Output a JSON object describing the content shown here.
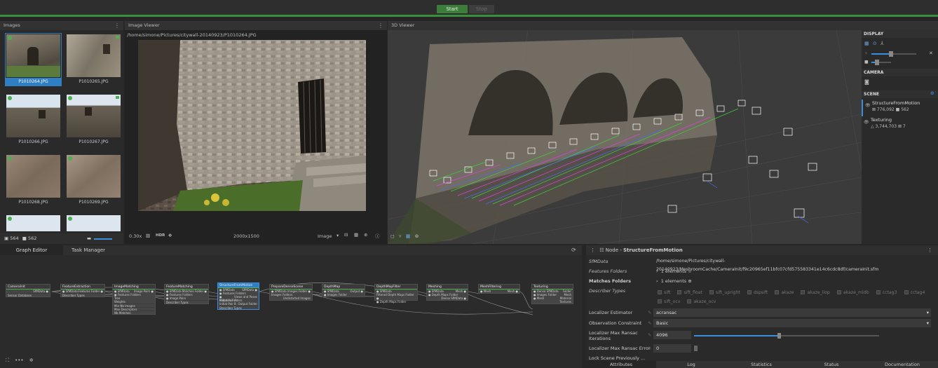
{
  "toolbar": {
    "start": "Start",
    "stop": "Stop"
  },
  "images_panel": {
    "title": "Images",
    "menu": "⋮",
    "counts": {
      "images": "564",
      "cameras": "562"
    },
    "thumbs": [
      {
        "label": "P1010264.JPG"
      },
      {
        "label": "P1010265.JPG"
      },
      {
        "label": "P1010266.JPG"
      },
      {
        "label": "P1010267.JPG"
      },
      {
        "label": "P1010268.JPG"
      },
      {
        "label": "P1010269.JPG"
      }
    ]
  },
  "image_viewer": {
    "title": "Image Viewer",
    "menu": "⋮",
    "path": "/home/simone/Pictures/citywall-20140923/P1010264.JPG",
    "zoom": "0.30x",
    "hdr": "HDR",
    "resolution": "2000x1500",
    "mode": "Image"
  },
  "viewer3d": {
    "title": "3D Viewer"
  },
  "display_panel": {
    "display": "DISPLAY",
    "camera": "CAMERA",
    "scene": "SCENE",
    "items": [
      {
        "name": "StructureFromMotion",
        "stats": "⊠ 776,092  ■ 562"
      },
      {
        "name": "Texturing",
        "stats": "△ 3,744,703  ⊠ 7"
      }
    ]
  },
  "graph_editor": {
    "tabs": [
      "Graph Editor",
      "Task Manager"
    ],
    "nodes": [
      {
        "title": "CameraInit",
        "inputs": [],
        "outputs": [
          "SfMData ●"
        ],
        "extra": [
          "Sensor Database"
        ]
      },
      {
        "title": "FeatureExtraction",
        "inputs": [
          "● SfMData"
        ],
        "outputs": [
          "Features Folder ●"
        ],
        "extra": [
          "Describer Types"
        ]
      },
      {
        "title": "ImageMatching",
        "inputs": [
          "● SfMData",
          "● Features Folders",
          "Tree",
          "Weights"
        ],
        "outputs": [
          "Image Pairs ●"
        ],
        "extra": [
          "Min Nb Images",
          "Max Descriptors",
          "Nb Matches"
        ]
      },
      {
        "title": "FeatureMatching",
        "inputs": [
          "● SfMData",
          "● Features Folders",
          "● Image Pairs"
        ],
        "outputs": [
          "Matches Folder ●"
        ],
        "extra": [
          "Describer Types"
        ]
      },
      {
        "title": "StructureFromMotion",
        "inputs": [
          "● SfMData",
          "● Features Folders",
          "● Matches Folders",
          "Initial Pair A",
          "Initial Pair B"
        ],
        "outputs": [
          "SfMData ●",
          "Views and Poses",
          "Output Folder"
        ],
        "extra": [
          "Describer Types"
        ]
      },
      {
        "title": "PrepareDenseScene",
        "inputs": [
          "● SfMData",
          "Images Folders"
        ],
        "outputs": [
          "Images Folder ●",
          "Undistorted Images"
        ],
        "extra": []
      },
      {
        "title": "DepthMap",
        "inputs": [
          "● SfMData",
          "● Images Folder"
        ],
        "outputs": [
          "Output ●"
        ],
        "extra": []
      },
      {
        "title": "DepthMapFilter",
        "inputs": [
          "● SfMData",
          "● Depth Maps Folder"
        ],
        "outputs": [
          "Filtered Depth Maps Folder ●"
        ],
        "extra": []
      },
      {
        "title": "Meshing",
        "inputs": [
          "● SfMData",
          "● Depth Maps Folder"
        ],
        "outputs": [
          "Mesh ●",
          "Dense SfMData ●"
        ],
        "extra": []
      },
      {
        "title": "MeshFiltering",
        "inputs": [
          "● Mesh"
        ],
        "outputs": [
          "Mesh ●"
        ],
        "extra": []
      },
      {
        "title": "Texturing",
        "inputs": [
          "● Dense SfMData",
          "● Images Folder",
          "● Mesh"
        ],
        "outputs": [
          "Folder",
          "Mesh",
          "Material",
          "Textures"
        ],
        "extra": []
      }
    ]
  },
  "node_panel": {
    "title_prefix": "Node - ",
    "title": "StructureFromMotion",
    "sfmdata_label": "SfMData",
    "sfmdata_value": "/home/simone/Pictures/citywall-20140923/MeshroomCache/CameraInit/f9c20965ef11bfc07cfd575583341e14c6cdc8df/cameraInit.sfm",
    "features_folders": "Features Folders",
    "matches_folders": "Matches Folders",
    "elements": "1 elements",
    "describer_types": "Describer Types",
    "describers": [
      "sift",
      "sift_float",
      "sift_upright",
      "dspsift",
      "akaze",
      "akaze_liop",
      "akaze_mldb",
      "cctag3",
      "cctag4",
      "sift_ocv",
      "akaze_ocv"
    ],
    "localizer_estimator": "Localizer Estimator",
    "localizer_estimator_value": "acransac",
    "observation_constraint": "Observation Constraint",
    "observation_constraint_value": "Basic",
    "max_iter_label": "Localizer Max Ransac Iterations",
    "max_iter_value": "4096",
    "max_iter_fraction": 0.46,
    "max_error_label": "Localizer Max Ransac Error",
    "max_error_value": "0",
    "lock_label": "Lock Scene Previously ..."
  },
  "bottom_tabs": [
    "Attributes",
    "Log",
    "Statistics",
    "Status",
    "Documentation"
  ]
}
